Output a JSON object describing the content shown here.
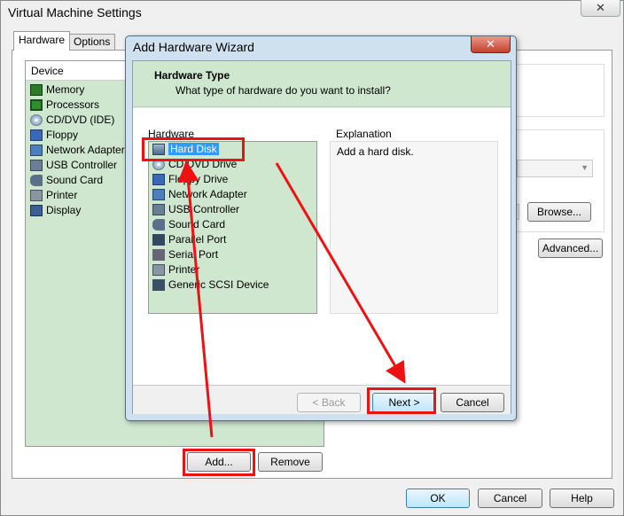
{
  "main": {
    "title": "Virtual Machine Settings",
    "close_icon": "✕",
    "tabs": [
      {
        "label": "Hardware"
      },
      {
        "label": "Options"
      }
    ],
    "device_header": "Device",
    "devices": [
      {
        "label": "Memory",
        "icon": "memory-icon"
      },
      {
        "label": "Processors",
        "icon": "processor-icon"
      },
      {
        "label": "CD/DVD (IDE)",
        "icon": "cd-dvd-icon"
      },
      {
        "label": "Floppy",
        "icon": "floppy-icon"
      },
      {
        "label": "Network Adapter",
        "icon": "network-adapter-icon"
      },
      {
        "label": "USB Controller",
        "icon": "usb-icon"
      },
      {
        "label": "Sound Card",
        "icon": "sound-card-icon"
      },
      {
        "label": "Printer",
        "icon": "printer-icon"
      },
      {
        "label": "Display",
        "icon": "display-icon"
      }
    ],
    "add_button": "Add...",
    "remove_button": "Remove",
    "browse_button": "Browse...",
    "advanced_button": "Advanced...",
    "ok_button": "OK",
    "cancel_button": "Cancel",
    "help_button": "Help"
  },
  "wizard": {
    "title": "Add Hardware Wizard",
    "close_icon": "✕",
    "header_title": "Hardware Type",
    "header_subtitle": "What type of hardware do you want to install?",
    "hardware_label": "Hardware",
    "hardware_items": [
      {
        "label": "Hard Disk",
        "icon": "hard-disk-icon",
        "selected": true
      },
      {
        "label": "CD/DVD Drive",
        "icon": "cd-dvd-icon"
      },
      {
        "label": "Floppy Drive",
        "icon": "floppy-icon"
      },
      {
        "label": "Network Adapter",
        "icon": "network-adapter-icon"
      },
      {
        "label": "USB Controller",
        "icon": "usb-icon"
      },
      {
        "label": "Sound Card",
        "icon": "sound-card-icon"
      },
      {
        "label": "Parallel Port",
        "icon": "parallel-port-icon"
      },
      {
        "label": "Serial Port",
        "icon": "serial-port-icon"
      },
      {
        "label": "Printer",
        "icon": "printer-icon"
      },
      {
        "label": "Generic SCSI Device",
        "icon": "scsi-device-icon"
      }
    ],
    "explanation_label": "Explanation",
    "explanation_text": "Add a hard disk.",
    "back_button": "< Back",
    "next_button": "Next >",
    "cancel_button": "Cancel"
  },
  "colors": {
    "highlight_box": "#ee1111",
    "annotation_arrow": "#ee1111",
    "list_background": "#cfe6cf",
    "selection": "#3399ff"
  }
}
